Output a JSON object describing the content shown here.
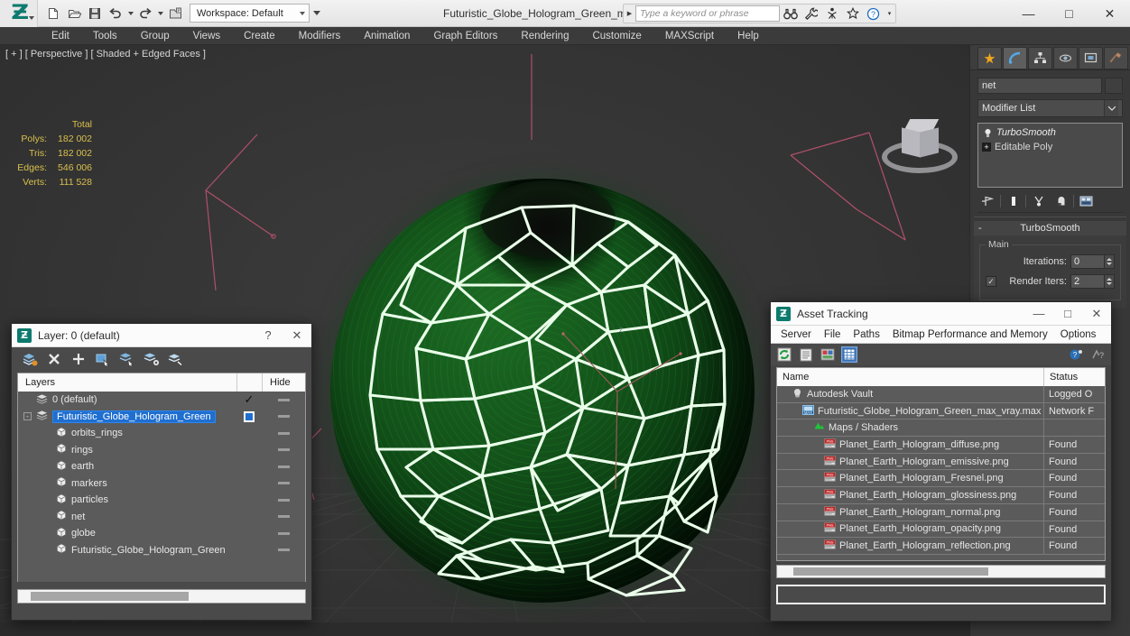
{
  "app": {
    "title": "Futuristic_Globe_Hologram_Green_max_vray.max",
    "workspace_label": "Workspace: Default",
    "search_placeholder": "Type a keyword or phrase",
    "quick_access": [
      "new-icon",
      "open-icon",
      "save-icon",
      "undo-icon",
      "redo-icon",
      "set-project-icon"
    ],
    "title_icons": [
      "binoculars-icon",
      "wrench-icon",
      "character-icon",
      "star-icon",
      "help-icon"
    ],
    "window_controls": [
      "minimize",
      "maximize",
      "close"
    ]
  },
  "menu": {
    "items": [
      "Edit",
      "Tools",
      "Group",
      "Views",
      "Create",
      "Modifiers",
      "Animation",
      "Graph Editors",
      "Rendering",
      "Customize",
      "MAXScript",
      "Help"
    ]
  },
  "viewport": {
    "label": "[ + ] [ Perspective ] [ Shaded + Edged Faces ]",
    "stats": {
      "header": "Total",
      "rows": [
        {
          "label": "Polys:",
          "value": "182 002"
        },
        {
          "label": "Tris:",
          "value": "182 002"
        },
        {
          "label": "Edges:",
          "value": "546 006"
        },
        {
          "label": "Verts:",
          "value": "111 528"
        }
      ]
    },
    "scene": {
      "object": "Futuristic globe hologram (green sphere with white polygon network)",
      "globe_color": "#13521a",
      "net_color": "#eaffea",
      "helper_color": "#b0506a",
      "background": "#373737"
    }
  },
  "command_panel": {
    "tabs": [
      "create-tab-icon",
      "modify-tab-icon",
      "hierarchy-tab-icon",
      "motion-tab-icon",
      "display-tab-icon",
      "utilities-tab-icon"
    ],
    "active_tab_index": 1,
    "object_name": "net",
    "modifier_list_label": "Modifier List",
    "stack": [
      {
        "label": "TurboSmooth",
        "italic": true
      },
      {
        "label": "Editable Poly",
        "italic": false
      }
    ],
    "stack_buttons": [
      "pin-stack-icon",
      "show-end-result-icon",
      "make-unique-icon",
      "remove-modifier-icon",
      "configure-sets-icon"
    ],
    "rollout": {
      "title": "TurboSmooth",
      "collapse_glyph": "-",
      "group_label": "Main",
      "params": [
        {
          "label": "Iterations:",
          "value": "0",
          "checkbox": null
        },
        {
          "label": "Render Iters:",
          "value": "2",
          "checkbox": true
        }
      ]
    }
  },
  "layer_dialog": {
    "title": "Layer: 0 (default)",
    "title_buttons": [
      "?",
      "close"
    ],
    "toolbar": [
      "new-layer-icon",
      "delete-layer-icon",
      "add-selection-icon",
      "select-objects-in-layer-icon",
      "select-highlighted-objects-icon",
      "highlight-selected-objects-icon",
      "hide-unhide-icon"
    ],
    "columns": {
      "name": "Layers",
      "hide": "Hide"
    },
    "rows": [
      {
        "name": "0 (default)",
        "indent": 0,
        "icon": "layer-icon",
        "selected": false,
        "active_check": true,
        "hide_dash": true,
        "expander": false
      },
      {
        "name": "Futuristic_Globe_Hologram_Green",
        "indent": 0,
        "icon": "layer-icon",
        "selected": true,
        "active_check": false,
        "hide_dash": true,
        "expander": true,
        "onoff_box": true
      },
      {
        "name": "orbits_rings",
        "indent": 1,
        "icon": "object-icon",
        "selected": false,
        "hide_dash": true
      },
      {
        "name": "rings",
        "indent": 1,
        "icon": "object-icon",
        "selected": false,
        "hide_dash": true
      },
      {
        "name": "earth",
        "indent": 1,
        "icon": "object-icon",
        "selected": false,
        "hide_dash": true
      },
      {
        "name": "markers",
        "indent": 1,
        "icon": "object-icon",
        "selected": false,
        "hide_dash": true
      },
      {
        "name": "particles",
        "indent": 1,
        "icon": "object-icon",
        "selected": false,
        "hide_dash": true
      },
      {
        "name": "net",
        "indent": 1,
        "icon": "object-icon",
        "selected": false,
        "hide_dash": true
      },
      {
        "name": "globe",
        "indent": 1,
        "icon": "object-icon",
        "selected": false,
        "hide_dash": true
      },
      {
        "name": "Futuristic_Globe_Hologram_Green",
        "indent": 1,
        "icon": "object-icon",
        "selected": false,
        "hide_dash": true
      }
    ]
  },
  "asset_dialog": {
    "title": "Asset Tracking",
    "menu": [
      "Server",
      "File",
      "Paths",
      "Bitmap Performance and Memory",
      "Options"
    ],
    "toolbar": [
      "refresh-icon",
      "list-view-icon",
      "thumbnail-view-icon",
      "grid-view-icon",
      "help-icon",
      "whats-this-icon"
    ],
    "active_toolbar_index": 3,
    "columns": {
      "name": "Name",
      "status": "Status"
    },
    "rows": [
      {
        "name": "Autodesk Vault",
        "status": "Logged O",
        "indent": 1,
        "icon": "vault-icon"
      },
      {
        "name": "Futuristic_Globe_Hologram_Green_max_vray.max",
        "status": "Network F",
        "indent": 2,
        "icon": "max-file-icon"
      },
      {
        "name": "Maps / Shaders",
        "status": "",
        "indent": 3,
        "icon": "maps-icon"
      },
      {
        "name": "Planet_Earth_Hologram_diffuse.png",
        "status": "Found",
        "indent": 4,
        "icon": "png-icon"
      },
      {
        "name": "Planet_Earth_Hologram_emissive.png",
        "status": "Found",
        "indent": 4,
        "icon": "png-icon"
      },
      {
        "name": "Planet_Earth_Hologram_Fresnel.png",
        "status": "Found",
        "indent": 4,
        "icon": "png-icon"
      },
      {
        "name": "Planet_Earth_Hologram_glossiness.png",
        "status": "Found",
        "indent": 4,
        "icon": "png-icon"
      },
      {
        "name": "Planet_Earth_Hologram_normal.png",
        "status": "Found",
        "indent": 4,
        "icon": "png-icon"
      },
      {
        "name": "Planet_Earth_Hologram_opacity.png",
        "status": "Found",
        "indent": 4,
        "icon": "png-icon"
      },
      {
        "name": "Planet_Earth_Hologram_reflection.png",
        "status": "Found",
        "indent": 4,
        "icon": "png-icon"
      }
    ],
    "status_bar_text": ""
  }
}
